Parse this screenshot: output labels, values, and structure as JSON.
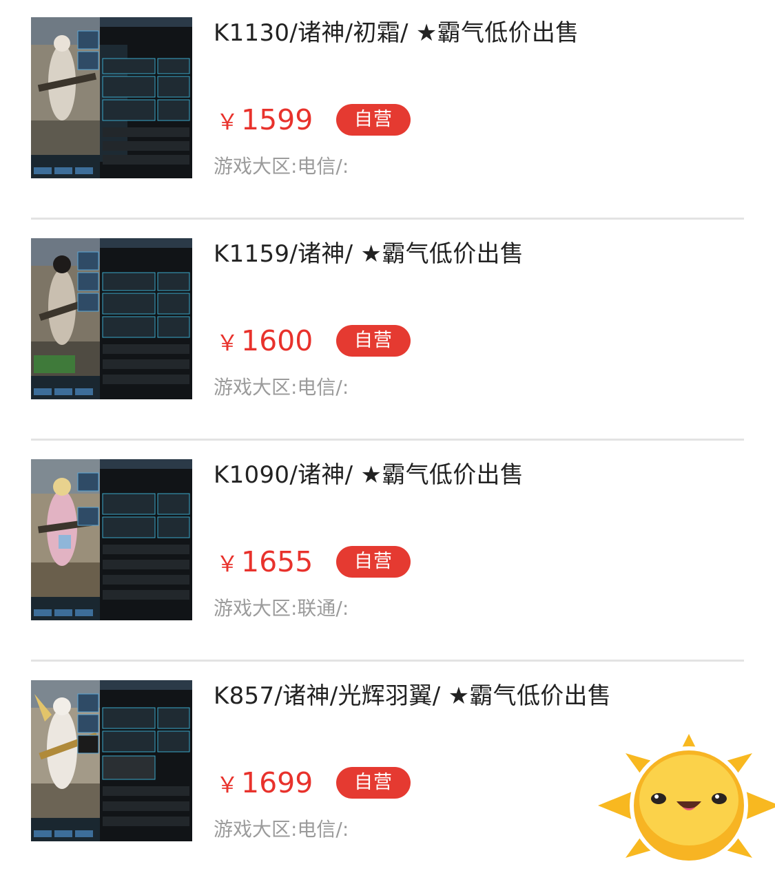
{
  "listings": [
    {
      "title": "K1130/诸神/初霜/ ★霸气低价出售",
      "currency": "￥",
      "price": "1599",
      "badge": "自营",
      "region": "游戏大区:电信/:",
      "thumbnail": "game-character-screenshot"
    },
    {
      "title": "K1159/诸神/ ★霸气低价出售",
      "currency": "￥",
      "price": "1600",
      "badge": "自营",
      "region": "游戏大区:电信/:",
      "thumbnail": "game-character-screenshot"
    },
    {
      "title": "K1090/诸神/ ★霸气低价出售",
      "currency": "￥",
      "price": "1655",
      "badge": "自营",
      "region": "游戏大区:联通/:",
      "thumbnail": "game-character-screenshot"
    },
    {
      "title": "K857/诸神/光辉羽翼/ ★霸气低价出售",
      "currency": "￥",
      "price": "1699",
      "badge": "自营",
      "region": "游戏大区:电信/:",
      "thumbnail": "game-character-screenshot"
    }
  ],
  "floating_icon": "sun-mascot-icon",
  "colors": {
    "price": "#e8322c",
    "badge_bg": "#e53a31",
    "badge_text": "#ffffff",
    "title": "#222222",
    "meta": "#9b9b9b",
    "divider": "#e3e3e3"
  }
}
